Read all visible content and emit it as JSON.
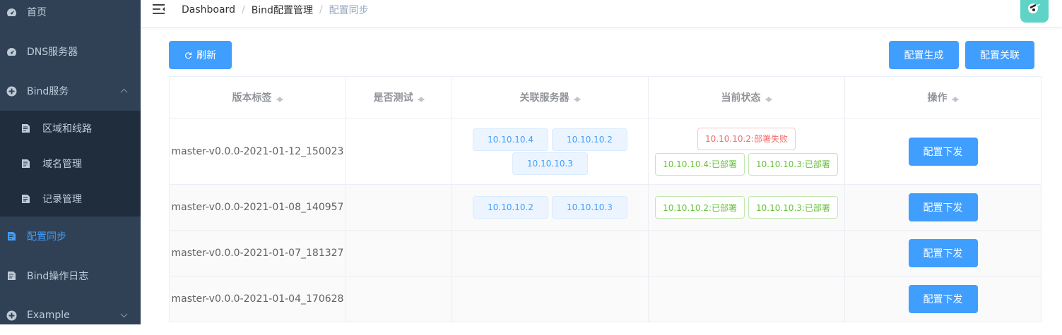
{
  "sidebar": {
    "items": [
      {
        "label": "首页",
        "icon": "dashboard-icon"
      },
      {
        "label": "DNS服务器",
        "icon": "dashboard-icon"
      },
      {
        "label": "Bind服务",
        "icon": "bind-icon"
      },
      {
        "label": "区域和线路",
        "icon": "document-icon"
      },
      {
        "label": "域名管理",
        "icon": "document-icon"
      },
      {
        "label": "记录管理",
        "icon": "document-icon"
      },
      {
        "label": "配置同步",
        "icon": "document-icon"
      },
      {
        "label": "Bind操作日志",
        "icon": "document-icon"
      },
      {
        "label": "Example",
        "icon": "example-icon"
      }
    ]
  },
  "breadcrumb": [
    "Dashboard",
    "Bind配置管理",
    "配置同步"
  ],
  "toolbar": {
    "refresh_label": "刷新",
    "generate_label": "配置生成",
    "link_label": "配置关联"
  },
  "table": {
    "headers": [
      "版本标签",
      "是否测试",
      "关联服务器",
      "当前状态",
      "操作"
    ],
    "rows": [
      {
        "version": "master-v0.0.0-2021-01-12_150023",
        "test": "",
        "servers": [
          "10.10.10.4",
          "10.10.10.2",
          "10.10.10.3"
        ],
        "status": [
          {
            "text": "10.10.10.2:部署失败",
            "type": "red"
          },
          {
            "text": "10.10.10.4:已部署",
            "type": "green"
          },
          {
            "text": "10.10.10.3:已部署",
            "type": "green"
          }
        ],
        "action": "配置下发"
      },
      {
        "version": "master-v0.0.0-2021-01-08_140957",
        "test": "",
        "servers": [
          "10.10.10.2",
          "10.10.10.3"
        ],
        "status": [
          {
            "text": "10.10.10.2:已部署",
            "type": "green"
          },
          {
            "text": "10.10.10.3:已部署",
            "type": "green"
          }
        ],
        "action": "配置下发"
      },
      {
        "version": "master-v0.0.0-2021-01-07_181327",
        "test": "",
        "servers": [],
        "status": [],
        "action": "配置下发"
      },
      {
        "version": "master-v0.0.0-2021-01-04_170628",
        "test": "",
        "servers": [],
        "status": [],
        "action": "配置下发"
      }
    ]
  },
  "colors": {
    "sidebar_bg": "#304156",
    "submenu_bg": "#1f2d3d",
    "primary": "#409eff",
    "success": "#67c23a",
    "danger": "#f56c6c"
  }
}
